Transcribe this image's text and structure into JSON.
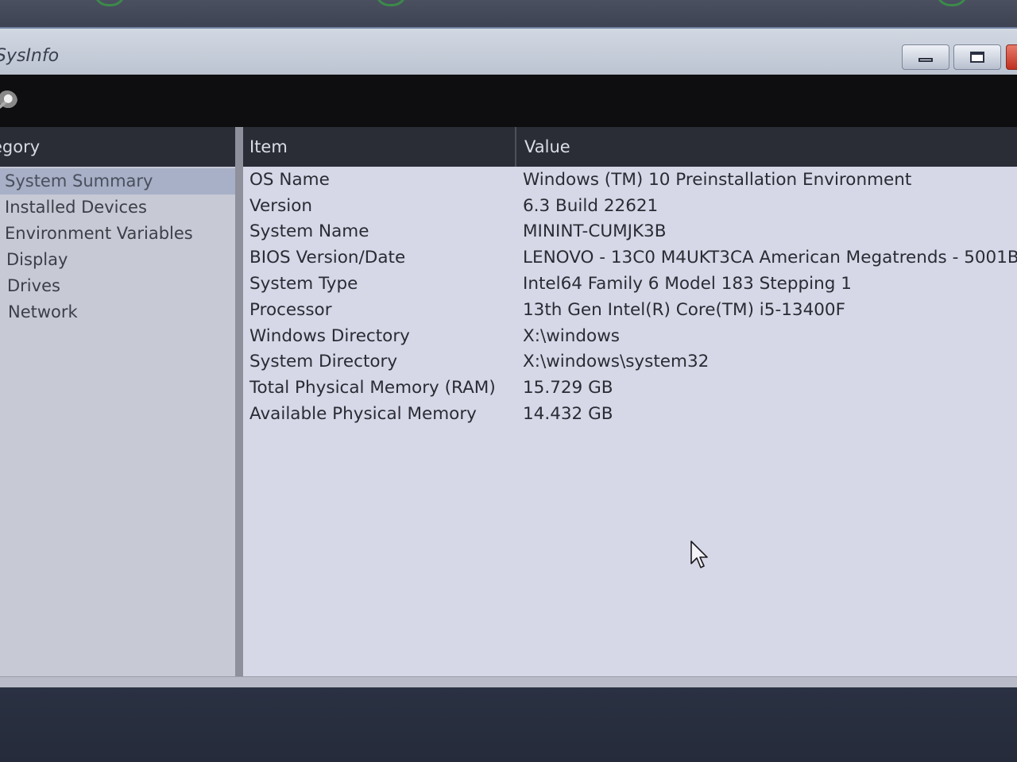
{
  "window": {
    "title": "SysInfo"
  },
  "left_pane": {
    "header": "egory",
    "items": [
      {
        "label": "System Summary",
        "selected": true
      },
      {
        "label": "Installed Devices"
      },
      {
        "label": "Environment Variables"
      },
      {
        "label": "Display"
      },
      {
        "label": "Drives"
      },
      {
        "label": "Network"
      }
    ]
  },
  "right_pane": {
    "columns": {
      "item": "Item",
      "value": "Value"
    },
    "rows": [
      {
        "item": "OS Name",
        "value": "Windows (TM) 10 Preinstallation Environment"
      },
      {
        "item": "Version",
        "value": "6.3 Build 22621"
      },
      {
        "item": "System Name",
        "value": "MININT-CUMJK3B"
      },
      {
        "item": "BIOS Version/Date",
        "value": "LENOVO - 13C0 M4UKT3CA American Megatrends - 5001B"
      },
      {
        "item": "System Type",
        "value": "Intel64 Family 6 Model 183 Stepping 1"
      },
      {
        "item": "Processor",
        "value": "13th Gen Intel(R) Core(TM) i5-13400F"
      },
      {
        "item": "Windows Directory",
        "value": "X:\\windows"
      },
      {
        "item": "System Directory",
        "value": "X:\\windows\\system32"
      },
      {
        "item": "Total Physical Memory (RAM)",
        "value": "15.729 GB"
      },
      {
        "item": "Available Physical Memory",
        "value": "14.432 GB"
      }
    ]
  },
  "icons": {
    "toolbar": "refresh-gear-icon",
    "minimize": "minimize-icon",
    "maximize": "maximize-icon",
    "close": "close-icon",
    "cursor": "mouse-pointer-icon"
  },
  "colors": {
    "selection": "#a7b0c6",
    "header_bg": "#2a2d36",
    "toolbar_bg": "#0e0e10"
  }
}
